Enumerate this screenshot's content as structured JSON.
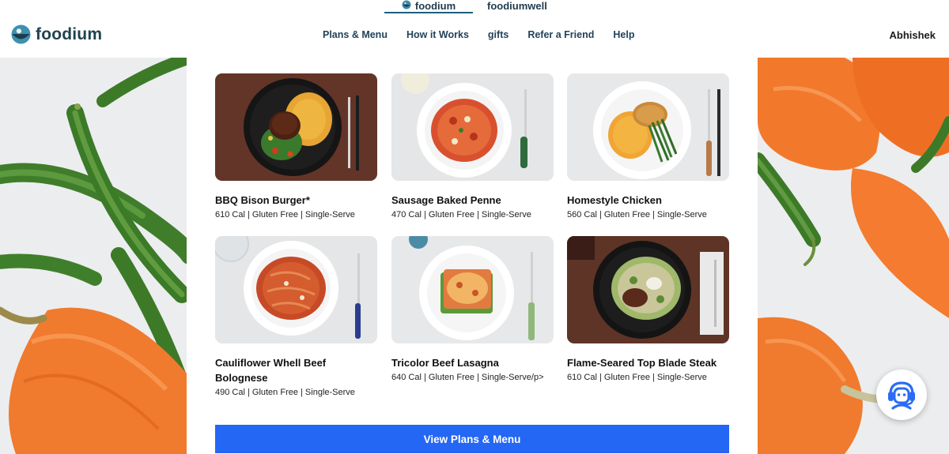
{
  "brand_switch": {
    "active": "foodium",
    "alt": "foodiumwell"
  },
  "header": {
    "logo_text": "foodium",
    "nav": [
      "Plans & Menu",
      "How it Works",
      "gifts",
      "Refer a Friend",
      "Help"
    ],
    "user_name": "Abhishek"
  },
  "meals": [
    {
      "name": "BBQ Bison Burger*",
      "meta": "610 Cal | Gluten Free | Single-Serve",
      "image": "dark-plate-burger-mac"
    },
    {
      "name": "Sausage Baked Penne",
      "meta": "470 Cal | Gluten Free | Single-Serve",
      "image": "white-plate-penne"
    },
    {
      "name": "Homestyle Chicken",
      "meta": "560 Cal | Gluten Free | Single-Serve",
      "image": "white-plate-chicken-greenbeans"
    },
    {
      "name": "Cauliflower Whell Beef Bolognese",
      "meta": "490 Cal | Gluten Free | Single-Serve",
      "image": "white-bowl-bolognese"
    },
    {
      "name": "Tricolor Beef Lasagna",
      "meta": "640 Cal | Gluten Free | Single-Serve/p>",
      "image": "white-plate-lasagna"
    },
    {
      "name": "Flame-Seared Top Blade Steak",
      "meta": "610 Cal | Gluten Free | Single-Serve",
      "image": "dark-plate-steak-salad"
    }
  ],
  "cta_label": "View Plans & Menu",
  "colors": {
    "brand_dark": "#20424f",
    "cta_blue": "#2467f5",
    "support_blue": "#2b6cf6"
  },
  "icons": {
    "logo": "plate-bowl-icon",
    "support": "headset-agent-icon"
  }
}
